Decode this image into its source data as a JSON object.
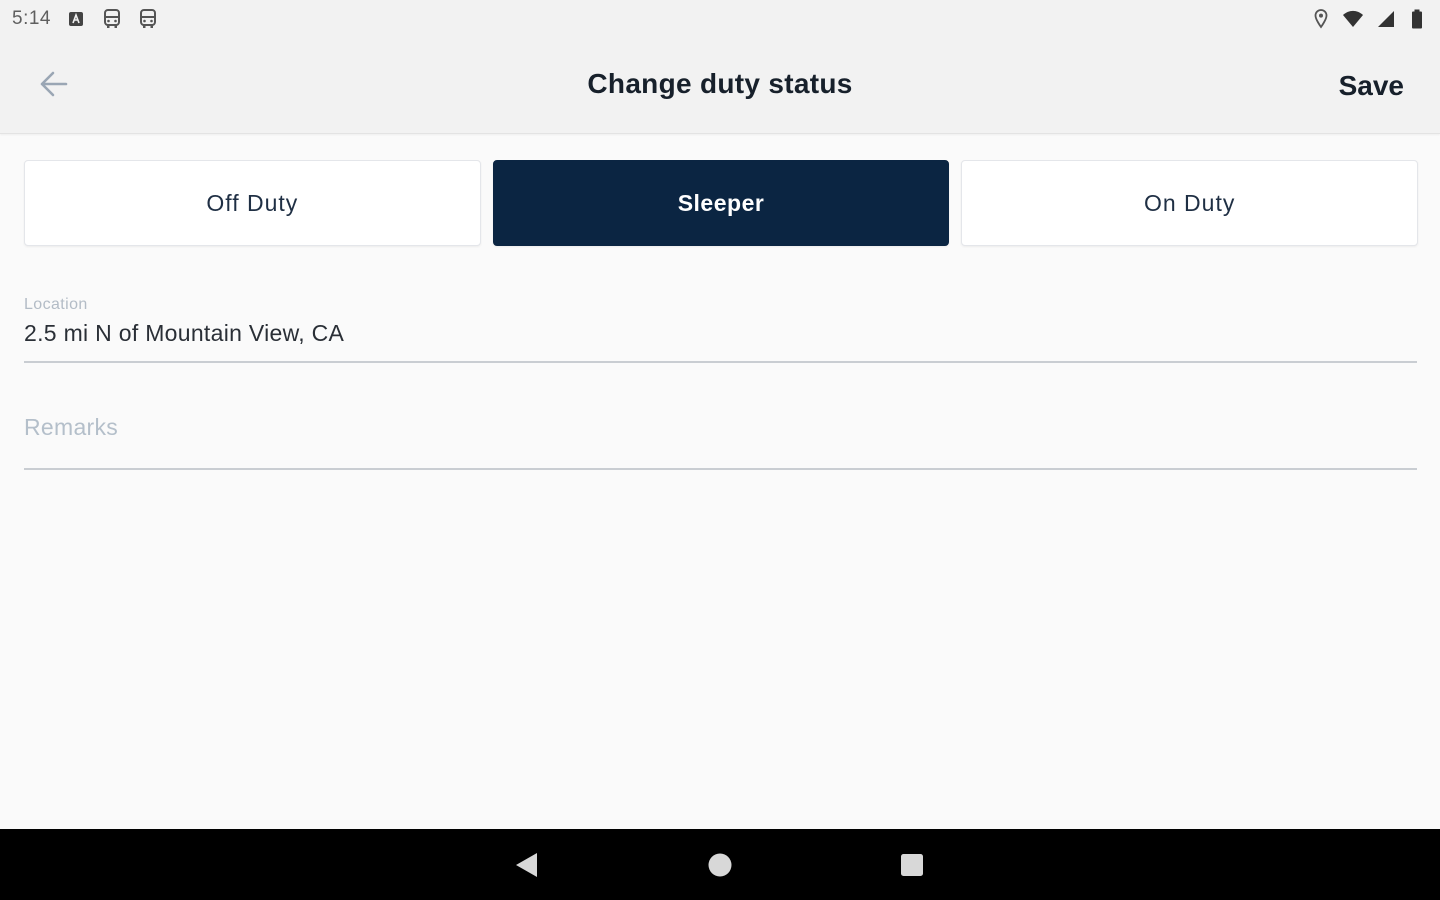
{
  "status_bar": {
    "time": "5:14",
    "left_icons": [
      "text-a-notification-icon",
      "bus-notification-icon",
      "bus-notification-icon"
    ],
    "right_icons": [
      "location-pin-icon",
      "wifi-icon",
      "cellular-signal-icon",
      "battery-icon"
    ]
  },
  "app_bar": {
    "back_icon": "arrow-left-icon",
    "title": "Change duty status",
    "save_label": "Save"
  },
  "duty_status": {
    "options": [
      "Off Duty",
      "Sleeper",
      "On Duty"
    ],
    "selected": "Sleeper",
    "selected_color": "#0b2542"
  },
  "location_field": {
    "label": "Location",
    "value": "2.5 mi N of Mountain View, CA"
  },
  "remarks_field": {
    "placeholder": "Remarks",
    "value": ""
  },
  "nav_bar": {
    "buttons": [
      "back-triangle-icon",
      "home-circle-icon",
      "recents-square-icon"
    ]
  }
}
